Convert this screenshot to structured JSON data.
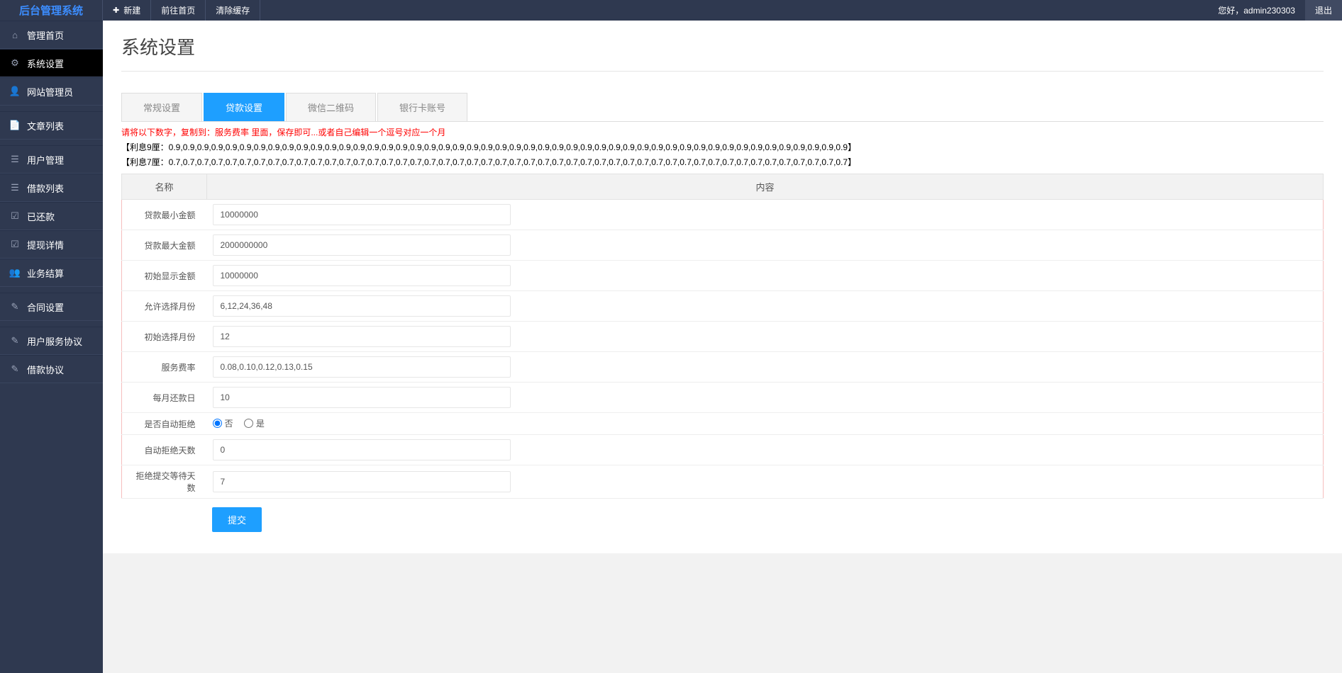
{
  "logo": "后台管理系统",
  "topnav": {
    "new": "新建",
    "home": "前往首页",
    "clear": "清除缓存"
  },
  "topright": {
    "greet": "您好，admin230303",
    "logout": "退出"
  },
  "sidebar": [
    {
      "icon": "⌂",
      "label": "管理首页",
      "name": "sidebar-item-dashboard",
      "active": false
    },
    {
      "icon": "⚙",
      "label": "系统设置",
      "name": "sidebar-item-system-settings",
      "active": true
    },
    {
      "icon": "👤",
      "label": "网站管理员",
      "name": "sidebar-item-admins",
      "active": false
    },
    {
      "sep": true
    },
    {
      "icon": "📄",
      "label": "文章列表",
      "name": "sidebar-item-articles",
      "active": false
    },
    {
      "sep": true
    },
    {
      "icon": "☰",
      "label": "用户管理",
      "name": "sidebar-item-users",
      "active": false
    },
    {
      "icon": "☰",
      "label": "借款列表",
      "name": "sidebar-item-loans",
      "active": false
    },
    {
      "icon": "☑",
      "label": "已还款",
      "name": "sidebar-item-repaid",
      "active": false
    },
    {
      "icon": "☑",
      "label": "提现详情",
      "name": "sidebar-item-withdraw",
      "active": false
    },
    {
      "icon": "👥",
      "label": "业务结算",
      "name": "sidebar-item-settlement",
      "active": false
    },
    {
      "sep": true
    },
    {
      "icon": "✎",
      "label": "合同设置",
      "name": "sidebar-item-contract",
      "active": false
    },
    {
      "sep": true
    },
    {
      "icon": "✎",
      "label": "用户服务协议",
      "name": "sidebar-item-user-agreement",
      "active": false
    },
    {
      "icon": "✎",
      "label": "借款协议",
      "name": "sidebar-item-loan-agreement",
      "active": false
    }
  ],
  "page": {
    "title": "系统设置"
  },
  "tabs": [
    {
      "label": "常规设置",
      "active": false,
      "name": "tab-general"
    },
    {
      "label": "贷款设置",
      "active": true,
      "name": "tab-loan"
    },
    {
      "label": "微信二维码",
      "active": false,
      "name": "tab-wechat-qr"
    },
    {
      "label": "银行卡账号",
      "active": false,
      "name": "tab-bank"
    }
  ],
  "help": {
    "line1": "请将以下数字，复制到：服务费率 里面，保存即可...或者自己编辑一个逗号对应一个月",
    "line2": "【利息9厘：0.9,0.9,0.9,0.9,0.9,0.9,0.9,0.9,0.9,0.9,0.9,0.9,0.9,0.9,0.9,0.9,0.9,0.9,0.9,0.9,0.9,0.9,0.9,0.9,0.9,0.9,0.9,0.9,0.9,0.9,0.9,0.9,0.9,0.9,0.9,0.9,0.9,0.9,0.9,0.9,0.9,0.9,0.9,0.9,0.9,0.9,0.9,0.9】",
    "line3": "【利息7厘：0.7,0.7,0.7,0.7,0.7,0.7,0.7,0.7,0.7,0.7,0.7,0.7,0.7,0.7,0.7,0.7,0.7,0.7,0.7,0.7,0.7,0.7,0.7,0.7,0.7,0.7,0.7,0.7,0.7,0.7,0.7,0.7,0.7,0.7,0.7,0.7,0.7,0.7,0.7,0.7,0.7,0.7,0.7,0.7,0.7,0.7,0.7,0.7】"
  },
  "table": {
    "head_name": "名称",
    "head_content": "内容"
  },
  "fields": {
    "min_amount": {
      "label": "贷款最小金额",
      "value": "10000000"
    },
    "max_amount": {
      "label": "贷款最大金额",
      "value": "2000000000"
    },
    "init_amount": {
      "label": "初始显示金额",
      "value": "10000000"
    },
    "months_opts": {
      "label": "允许选择月份",
      "value": "6,12,24,36,48"
    },
    "months_init": {
      "label": "初始选择月份",
      "value": "12"
    },
    "fee_rate": {
      "label": "服务费率",
      "value": "0.08,0.10,0.12,0.13,0.15"
    },
    "repay_day": {
      "label": "每月还款日",
      "value": "10"
    },
    "auto_reject": {
      "label": "是否自动拒绝",
      "no": "否",
      "yes": "是",
      "selected": "no"
    },
    "reject_days": {
      "label": "自动拒绝天数",
      "value": "0"
    },
    "wait_days": {
      "label": "拒绝提交等待天数",
      "value": "7"
    }
  },
  "submit": "提交"
}
